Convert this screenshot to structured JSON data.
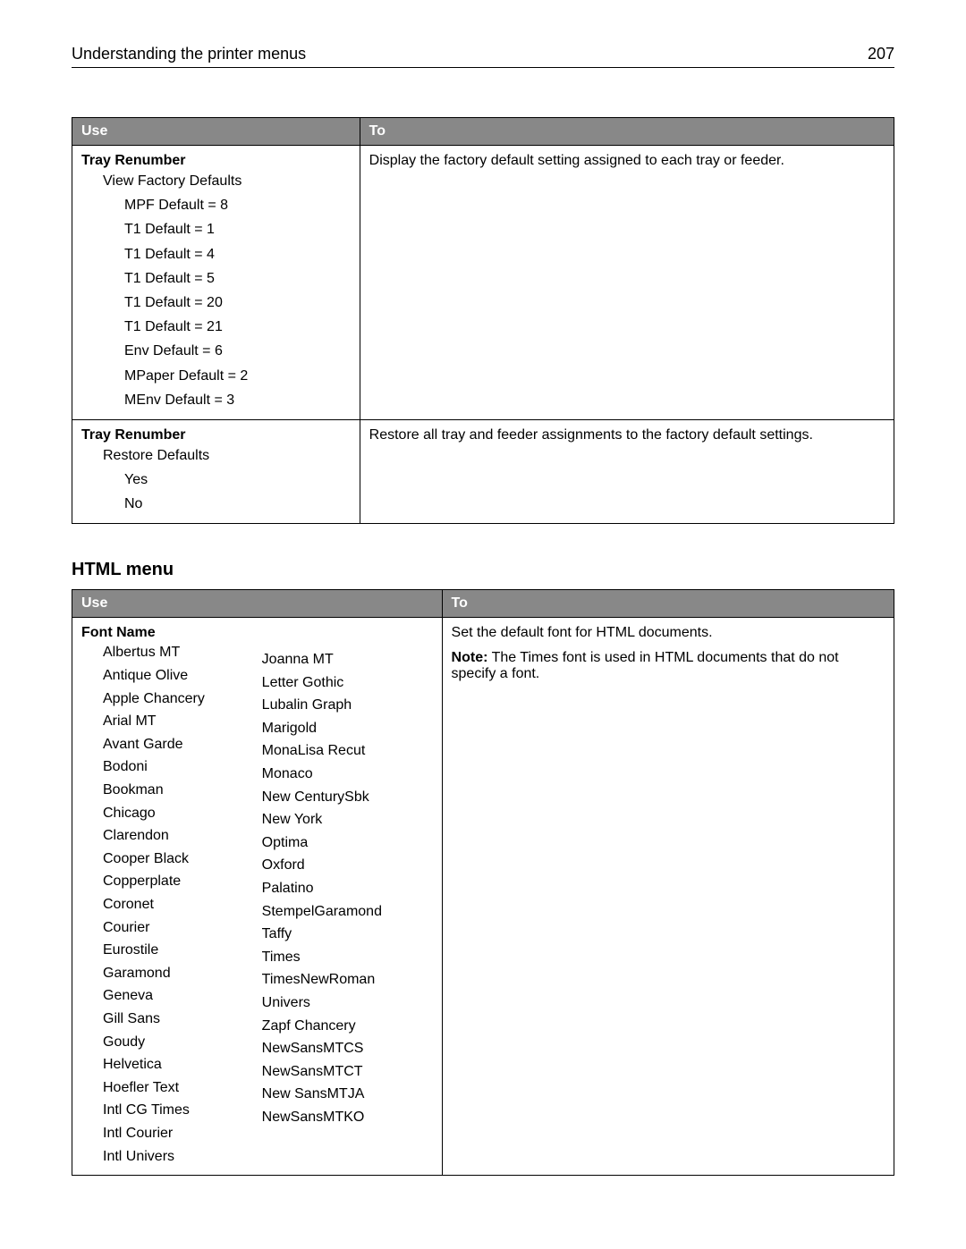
{
  "header": {
    "title": "Understanding the printer menus",
    "page_number": "207"
  },
  "table1": {
    "col_use": "Use",
    "col_to": "To",
    "row1": {
      "title": "Tray Renumber",
      "sub": "View Factory Defaults",
      "items": [
        "MPF Default = 8",
        "T1 Default = 1",
        "T1 Default = 4",
        "T1 Default = 5",
        "T1 Default = 20",
        "T1 Default = 21",
        "Env Default = 6",
        "MPaper Default = 2",
        "MEnv Default = 3"
      ],
      "to": "Display the factory default setting assigned to each tray or feeder."
    },
    "row2": {
      "title": "Tray Renumber",
      "sub": "Restore Defaults",
      "items": [
        "Yes",
        "No"
      ],
      "to": "Restore all tray and feeder assignments to the factory default settings."
    }
  },
  "section2_heading": "HTML menu",
  "table2": {
    "col_use": "Use",
    "col_to": "To",
    "font_name_label": "Font Name",
    "fonts_col1": [
      "Albertus MT",
      "Antique Olive",
      "Apple Chancery",
      "Arial MT",
      "Avant Garde",
      "Bodoni",
      "Bookman",
      "Chicago",
      "Clarendon",
      "Cooper Black",
      "Copperplate",
      "Coronet",
      "Courier",
      "Eurostile",
      "Garamond",
      "Geneva",
      "Gill Sans",
      "Goudy",
      "Helvetica",
      "Hoefler Text",
      "Intl CG Times",
      "Intl Courier",
      "Intl Univers"
    ],
    "fonts_col2": [
      "Joanna MT",
      "Letter Gothic",
      "Lubalin Graph",
      "Marigold",
      "MonaLisa Recut",
      "Monaco",
      "New CenturySbk",
      "New York",
      "Optima",
      "Oxford",
      "Palatino",
      "StempelGaramond",
      "Taffy",
      "Times",
      "TimesNewRoman",
      "Univers",
      "Zapf Chancery",
      "NewSansMTCS",
      "NewSansMTCT",
      "New SansMTJA",
      "NewSansMTKO"
    ],
    "to_line1": "Set the default font for HTML documents.",
    "note_label": "Note:",
    "note_text": " The Times font is used in HTML documents that do not specify a font."
  }
}
